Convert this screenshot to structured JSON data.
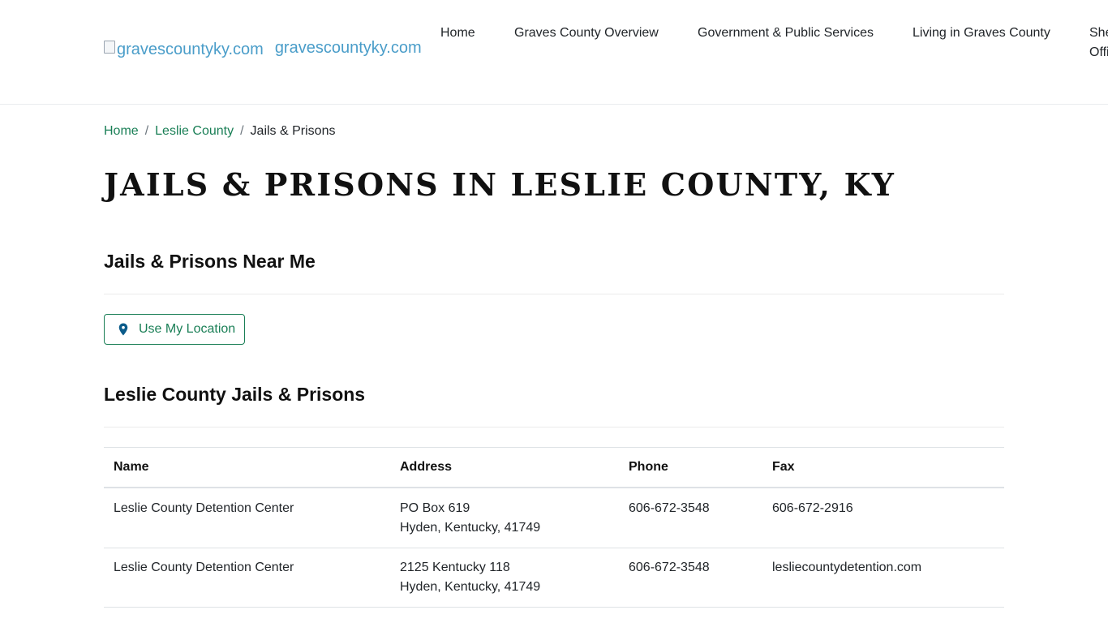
{
  "header": {
    "logo_alt": "gravescountyky.com",
    "site_name": "gravescountyky.com"
  },
  "nav": {
    "items": [
      {
        "label": "Home"
      },
      {
        "label": "Graves County Overview"
      },
      {
        "label": "Government & Public Services"
      },
      {
        "label": "Living in Graves County"
      },
      {
        "label": "Sheriff's Office"
      }
    ]
  },
  "breadcrumb": {
    "items": [
      {
        "label": "Home"
      },
      {
        "label": "Leslie County"
      }
    ],
    "separator": "/",
    "current": "Jails & Prisons"
  },
  "page": {
    "title": "JAILS & PRISONS IN LESLIE COUNTY, KY"
  },
  "near_me": {
    "heading": "Jails & Prisons Near Me",
    "button_label": "Use My Location"
  },
  "listing": {
    "heading": "Leslie County Jails & Prisons",
    "columns": [
      "Name",
      "Address",
      "Phone",
      "Fax"
    ],
    "rows": [
      {
        "name": "Leslie County Detention Center",
        "address_line1": "PO Box 619",
        "address_line2": "Hyden, Kentucky, 41749",
        "phone": "606-672-3548",
        "fax": "606-672-2916"
      },
      {
        "name": "Leslie County Detention Center",
        "address_line1": "2125 Kentucky 118",
        "address_line2": "Hyden, Kentucky, 41749",
        "phone": "606-672-3548",
        "fax": "lesliecountydetention.com"
      }
    ]
  },
  "colors": {
    "link_green": "#1a7f56",
    "brand_blue": "#4a9dc9",
    "pin_blue": "#0b5b8a"
  }
}
